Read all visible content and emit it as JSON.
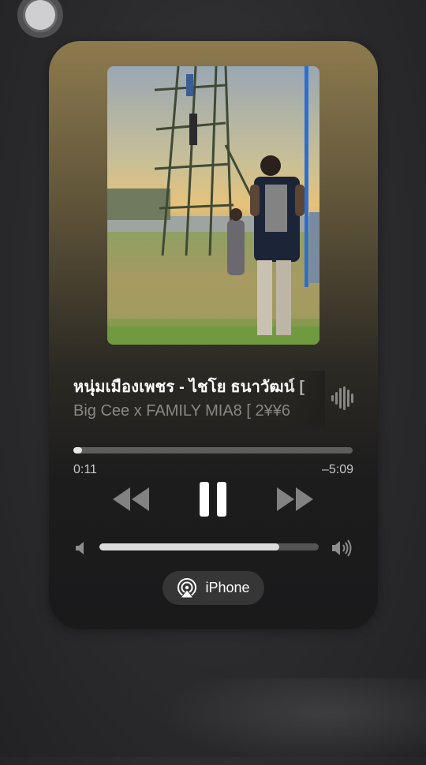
{
  "now_playing": {
    "title": "หนุ่มเมืองเพชร - ไชโย ธนาวัฒน์ [",
    "artist": "Big Cee x FAMILY MIA8 [ 2¥¥6",
    "artwork_icon": "album-artwork-photo",
    "playing_indicator_icon": "waveform-icon"
  },
  "progress": {
    "elapsed": "0:11",
    "remaining": "–5:09",
    "fraction": 0.03
  },
  "controls": {
    "rewind_icon": "backward-icon",
    "pause_icon": "pause-icon",
    "forward_icon": "forward-icon"
  },
  "volume": {
    "level": 0.82,
    "low_icon": "speaker-low-icon",
    "high_icon": "speaker-high-icon"
  },
  "output": {
    "device_label": "iPhone",
    "icon": "airplay-audio-icon"
  },
  "colors": {
    "card_top": "#8d7a4e",
    "card_bottom": "#1a1a1b",
    "background": "#2b2b2d"
  }
}
